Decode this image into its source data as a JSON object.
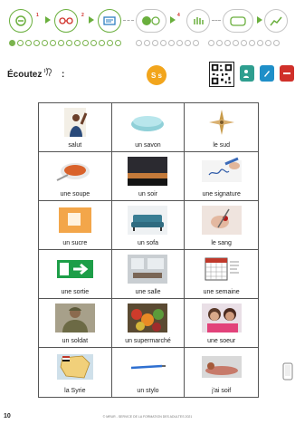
{
  "listen": {
    "label": "Écoutez",
    "colon": ":",
    "sound_badge": "S s"
  },
  "vocab": [
    {
      "word": "salut",
      "icon": "man-waving"
    },
    {
      "word": "un savon",
      "icon": "soap"
    },
    {
      "word": "le sud",
      "icon": "compass"
    },
    {
      "word": "une soupe",
      "icon": "soup-bowl"
    },
    {
      "word": "un soir",
      "icon": "evening-sky"
    },
    {
      "word": "une signature",
      "icon": "signing-hand"
    },
    {
      "word": "un sucre",
      "icon": "sugar-cube"
    },
    {
      "word": "un sofa",
      "icon": "sofa"
    },
    {
      "word": "le sang",
      "icon": "blood-drop"
    },
    {
      "word": "une sortie",
      "icon": "exit-sign"
    },
    {
      "word": "une salle",
      "icon": "room"
    },
    {
      "word": "une semaine",
      "icon": "calendar"
    },
    {
      "word": "un soldat",
      "icon": "soldier"
    },
    {
      "word": "un supermarché",
      "icon": "produce"
    },
    {
      "word": "une soeur",
      "icon": "sisters"
    },
    {
      "word": "la Syrie",
      "icon": "syria-map"
    },
    {
      "word": "un stylo",
      "icon": "pen"
    },
    {
      "word": "j'ai soif",
      "icon": "thirsty-person"
    }
  ],
  "footer": {
    "page_number": "10",
    "credit": "© MRUR - SERVICE DE LA FORMATION DES ADULTES 2021"
  },
  "colors": {
    "accent_green": "#6aaf3d",
    "badge_orange": "#f2a51c",
    "red": "#d0302a",
    "teal": "#2e9e8f"
  }
}
